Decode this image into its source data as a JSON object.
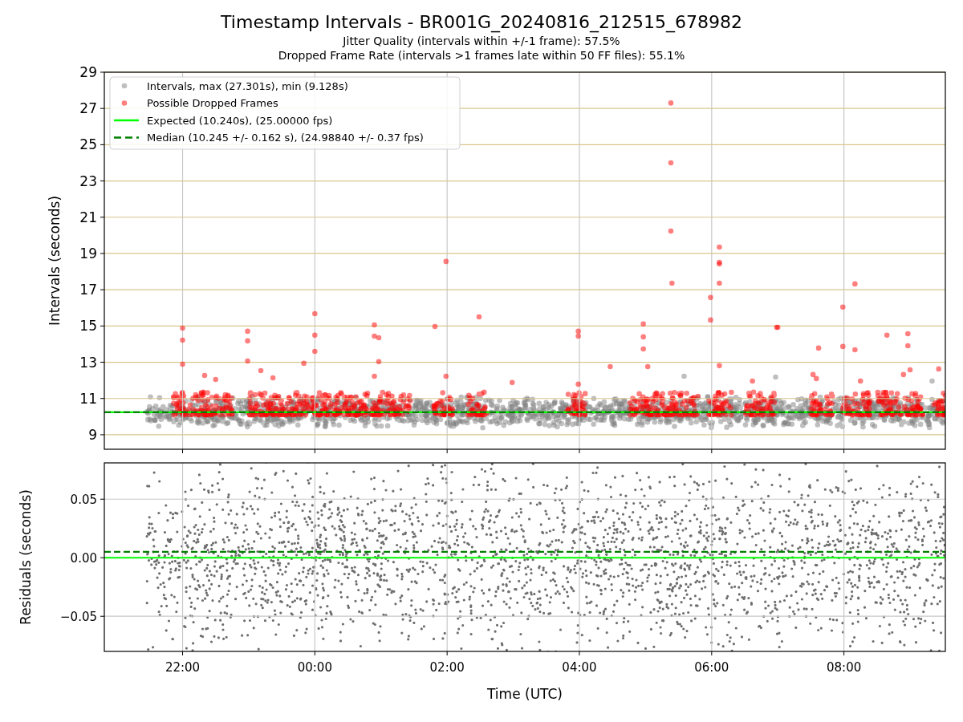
{
  "figure": {
    "title": "Timestamp Intervals - BR001G_20240816_212515_678982",
    "subtitles": [
      "Jitter Quality (intervals within +/-1 frame): 57.5%",
      "Dropped Frame Rate (intervals >1 frames late within 50 FF files): 55.1%"
    ]
  },
  "panels": [
    {
      "chart_data": {
        "type": "scatter",
        "ylabel": "Intervals (seconds)",
        "grid": true,
        "legend": true,
        "xlim": [
          "2024-08-16T20:49",
          "2024-08-17T09:32"
        ],
        "ylim": [
          8.2,
          29
        ],
        "yticks": [
          9,
          11,
          13,
          15,
          17,
          19,
          21,
          23,
          25,
          27,
          29
        ],
        "x": [
          "2024-08-16T22:00",
          "2024-08-16T22:00",
          "2024-08-16T22:00",
          "2024-08-16T22:20",
          "2024-08-16T22:30",
          "2024-08-16T22:59",
          "2024-08-16T22:59",
          "2024-08-16T22:59",
          "2024-08-16T23:11",
          "2024-08-16T23:22",
          "2024-08-16T23:50",
          "2024-08-17T00:00",
          "2024-08-17T00:00",
          "2024-08-17T00:00",
          "2024-08-17T00:54",
          "2024-08-17T00:54",
          "2024-08-17T00:58",
          "2024-08-17T00:58",
          "2024-08-17T00:54",
          "2024-08-17T01:49",
          "2024-08-17T01:59",
          "2024-08-17T01:59",
          "2024-08-17T02:29",
          "2024-08-17T02:59",
          "2024-08-17T03:59",
          "2024-08-17T03:59",
          "2024-08-17T03:59",
          "2024-08-17T04:28",
          "2024-08-17T04:58",
          "2024-08-17T04:58",
          "2024-08-17T04:58",
          "2024-08-17T05:02",
          "2024-08-17T05:23",
          "2024-08-17T05:23",
          "2024-08-17T05:23",
          "2024-08-17T05:24",
          "2024-08-17T05:59",
          "2024-08-17T05:59",
          "2024-08-17T06:07",
          "2024-08-17T06:07",
          "2024-08-17T06:07",
          "2024-08-17T06:07",
          "2024-08-17T06:07",
          "2024-08-17T06:37",
          "2024-08-17T06:38",
          "2024-08-17T06:59",
          "2024-08-17T07:00",
          "2024-08-17T07:32",
          "2024-08-17T07:35",
          "2024-08-17T07:37",
          "2024-08-17T07:59",
          "2024-08-17T07:59",
          "2024-08-17T08:10",
          "2024-08-17T08:10",
          "2024-08-17T08:15",
          "2024-08-17T08:21",
          "2024-08-17T08:39",
          "2024-08-17T08:54",
          "2024-08-17T08:58",
          "2024-08-17T08:58",
          "2024-08-17T09:00",
          "2024-08-17T09:26",
          "2024-08-17T05:35",
          "2024-08-17T06:58",
          "2024-08-17T09:20"
        ],
        "series": [
          {
            "name": "Intervals, max (27.301s), min (9.128s)",
            "color": "#808080",
            "values": [
              null,
              null,
              null,
              null,
              null,
              null,
              null,
              null,
              null,
              null,
              null,
              null,
              null,
              null,
              null,
              null,
              null,
              null,
              null,
              null,
              null,
              null,
              null,
              null,
              null,
              null,
              null,
              null,
              null,
              null,
              null,
              null,
              null,
              null,
              null,
              null,
              null,
              null,
              null,
              null,
              null,
              null,
              null,
              null,
              null,
              null,
              null,
              null,
              null,
              null,
              null,
              null,
              null,
              null,
              null,
              null,
              null,
              null,
              null,
              null,
              null,
              null,
              12.23,
              12.18,
              11.96
            ]
          },
          {
            "name": "Possible Dropped Frames",
            "color": "#ff0000",
            "values": [
              14.88,
              14.22,
              12.89,
              12.27,
              12.05,
              14.71,
              14.18,
              13.07,
              12.54,
              12.14,
              12.94,
              15.68,
              14.49,
              13.6,
              15.06,
              14.44,
              14.35,
              13.03,
              12.23,
              14.97,
              18.56,
              12.23,
              15.5,
              11.88,
              14.71,
              14.44,
              11.79,
              12.76,
              15.11,
              14.4,
              13.73,
              12.76,
              27.3,
              24.0,
              20.24,
              17.36,
              16.57,
              15.33,
              19.35,
              18.51,
              18.42,
              17.36,
              12.81,
              11.96,
              11.35,
              14.93,
              14.93,
              12.32,
              12.1,
              13.78,
              16.04,
              13.87,
              17.32,
              13.69,
              11.96,
              11.3,
              14.49,
              12.32,
              14.57,
              13.91,
              12.58,
              12.63,
              null,
              null,
              null
            ]
          }
        ],
        "ref_lines": [
          {
            "axis": "y",
            "value": 10.24,
            "label": "Expected (10.240s), (25.00000 fps)",
            "color": "#00ff00"
          },
          {
            "axis": "y",
            "value": 10.245,
            "label": "Median (10.245 +/- 0.162 s), (24.98840 +/- 0.37 fps)",
            "color": "#008000"
          }
        ]
      }
    },
    {
      "chart_data": {
        "type": "scatter",
        "xlabel": "Time (UTC)",
        "ylabel": "Residuals (seconds)",
        "grid": true,
        "xlim": [
          "2024-08-16T20:49",
          "2024-08-17T09:32"
        ],
        "ylim": [
          -0.08,
          0.081
        ],
        "xticks": [
          {
            "value": "2024-08-16T22:00",
            "label": "22:00"
          },
          {
            "value": "2024-08-17T00:00",
            "label": "00:00"
          },
          {
            "value": "2024-08-17T02:00",
            "label": "02:00"
          },
          {
            "value": "2024-08-17T04:00",
            "label": "04:00"
          },
          {
            "value": "2024-08-17T06:00",
            "label": "06:00"
          },
          {
            "value": "2024-08-17T08:00",
            "label": "08:00"
          }
        ],
        "yticks": [
          {
            "value": 0.05,
            "label": "0.05"
          },
          {
            "value": 0,
            "label": "0.00"
          },
          {
            "value": -0.05,
            "label": "−0.05"
          }
        ],
        "ref_lines": [
          {
            "axis": "y",
            "value": 0,
            "color": "#00ff00"
          },
          {
            "axis": "y",
            "value": 0.005,
            "color": "#008000"
          }
        ]
      }
    }
  ]
}
